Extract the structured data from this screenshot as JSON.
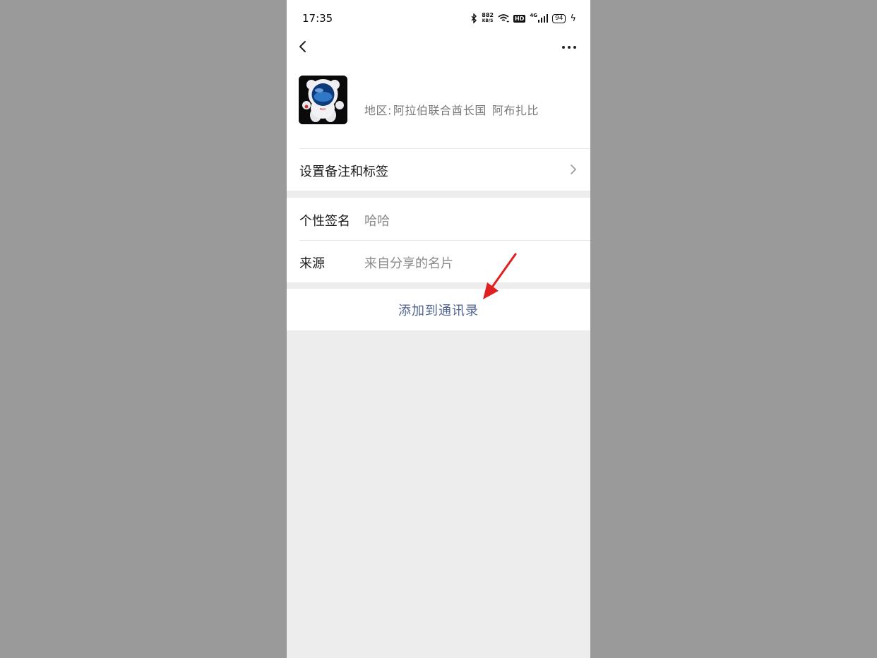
{
  "status_bar": {
    "time": "17:35",
    "speed_value": "882",
    "speed_unit": "KB/S",
    "hd_label": "HD",
    "network": "4G",
    "battery": "94",
    "icons": [
      "bluetooth-icon",
      "wifi-icon",
      "signal-icon",
      "battery-icon",
      "charging-icon"
    ]
  },
  "nav": {
    "back_icon": "chevron-left-icon",
    "more_icon": "more-dots-icon"
  },
  "profile": {
    "region_label": "地区:",
    "region_country": "阿拉伯联合酋长国",
    "region_city": "阿布扎比"
  },
  "remark_row": {
    "title": "设置备注和标签"
  },
  "signature_row": {
    "key": "个性签名",
    "value": "哈哈"
  },
  "source_row": {
    "key": "来源",
    "value": "来自分享的名片"
  },
  "action": {
    "add_label": "添加到通讯录"
  },
  "colors": {
    "backdrop": "#9a9a9a",
    "page_bg": "#ededed",
    "link_blue": "#4f6390",
    "annotation_arrow": "#e02020"
  }
}
